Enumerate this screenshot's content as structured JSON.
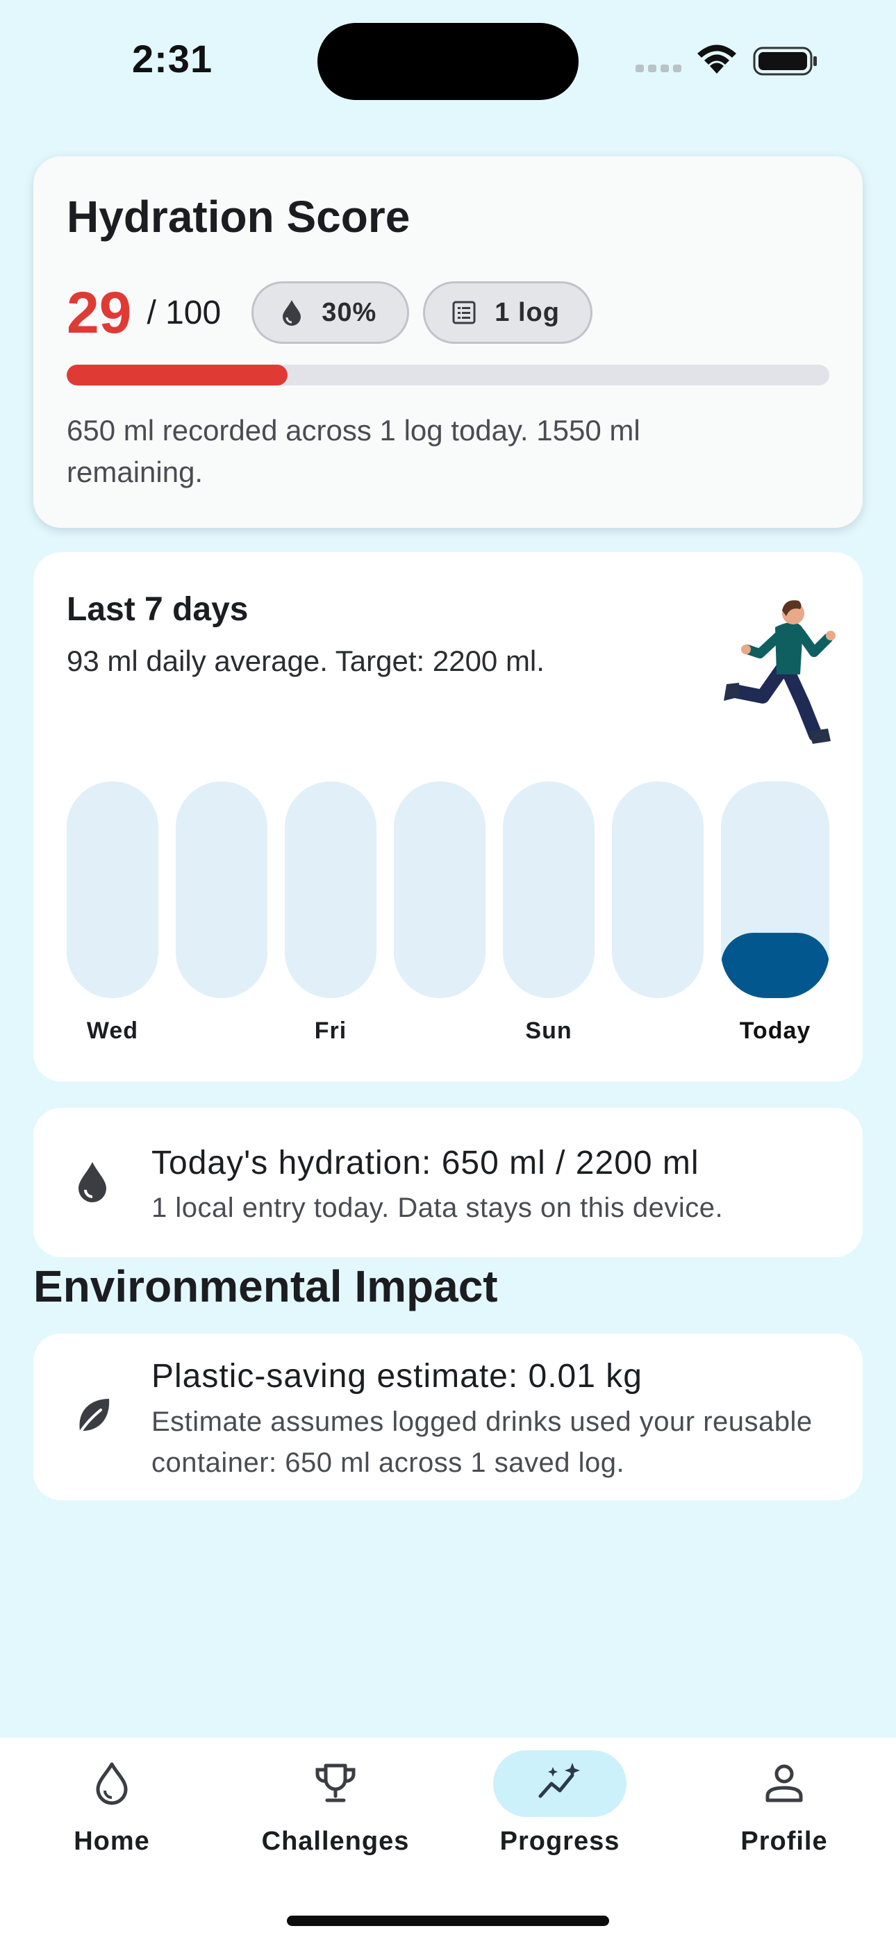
{
  "status_bar": {
    "time": "2:31"
  },
  "score_card": {
    "title": "Hydration Score",
    "score": "29",
    "score_max": "/ 100",
    "score_fraction": 0.29,
    "chips": [
      {
        "icon": "water-drop-icon",
        "label": "30%"
      },
      {
        "icon": "list-icon",
        "label": "1 log"
      }
    ],
    "description": "650 ml recorded across 1 log today. 1550 ml remaining.",
    "accent_color": "#e03a35"
  },
  "week_card": {
    "title": "Last 7 days",
    "subtitle": "93 ml daily average. Target: 2200 ml.",
    "illustration": "running-person-illustration",
    "days": [
      {
        "label": "Wed",
        "fill": 0
      },
      {
        "label": "",
        "fill": 0
      },
      {
        "label": "Fri",
        "fill": 0
      },
      {
        "label": "",
        "fill": 0
      },
      {
        "label": "Sun",
        "fill": 0
      },
      {
        "label": "",
        "fill": 0
      },
      {
        "label": "Today",
        "fill": 0.3
      }
    ],
    "bar_color": "#02578f"
  },
  "hydration_row": {
    "icon": "water-drop-icon",
    "title": "Today's hydration: 650 ml / 2200 ml",
    "subtitle": "1 local entry today. Data stays on this device."
  },
  "environment": {
    "heading": "Environmental Impact",
    "icon": "leaf-icon",
    "title": "Plastic-saving estimate: 0.01 kg",
    "subtitle": "Estimate assumes logged drinks used your reusable container: 650 ml across 1 saved log."
  },
  "bottom_nav": {
    "items": [
      {
        "label": "Home",
        "icon": "water-drop-outline-icon",
        "active": false
      },
      {
        "label": "Challenges",
        "icon": "trophy-icon",
        "active": false
      },
      {
        "label": "Progress",
        "icon": "sparkle-chart-icon",
        "active": true
      },
      {
        "label": "Profile",
        "icon": "person-icon",
        "active": false
      }
    ]
  }
}
